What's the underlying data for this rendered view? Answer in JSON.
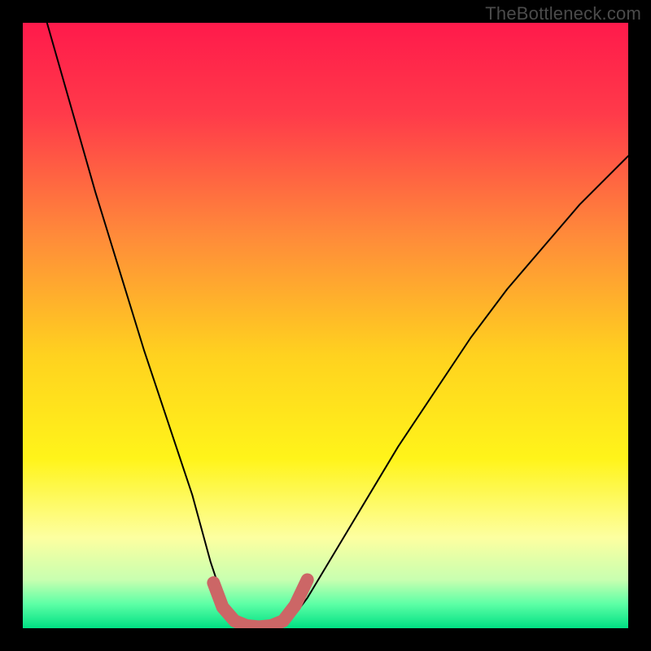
{
  "watermark": "TheBottleneck.com",
  "chart_data": {
    "type": "line",
    "title": "",
    "xlabel": "",
    "ylabel": "",
    "x_range": [
      0,
      100
    ],
    "y_range": [
      0,
      100
    ],
    "gradient_stops": [
      {
        "offset": 0.0,
        "color": "#ff1a4b"
      },
      {
        "offset": 0.15,
        "color": "#ff3a4a"
      },
      {
        "offset": 0.35,
        "color": "#ff8a3a"
      },
      {
        "offset": 0.55,
        "color": "#ffd21f"
      },
      {
        "offset": 0.72,
        "color": "#fff41a"
      },
      {
        "offset": 0.85,
        "color": "#fdffa0"
      },
      {
        "offset": 0.92,
        "color": "#c8ffb0"
      },
      {
        "offset": 0.96,
        "color": "#5dffa6"
      },
      {
        "offset": 1.0,
        "color": "#00e083"
      }
    ],
    "curve": {
      "description": "V-shaped bottleneck curve; value is ~0 near x≈34–44 and rises steeply toward both sides",
      "x": [
        0,
        4,
        8,
        12,
        16,
        20,
        24,
        28,
        31,
        33,
        36,
        40,
        44,
        47,
        50,
        56,
        62,
        68,
        74,
        80,
        86,
        92,
        98,
        100
      ],
      "y": [
        118,
        100,
        86,
        72,
        59,
        46,
        34,
        22,
        11,
        5,
        1,
        0,
        1,
        5,
        10,
        20,
        30,
        39,
        48,
        56,
        63,
        70,
        76,
        78
      ]
    },
    "trough_overlay": {
      "description": "Thick salmon-colored rounded U overlay marking the flat trough",
      "color": "#cc6666",
      "stroke_width": 16,
      "x": [
        31.5,
        33,
        35,
        37,
        39,
        41,
        43,
        45,
        47
      ],
      "y": [
        7.5,
        3.5,
        1.2,
        0.4,
        0.2,
        0.4,
        1.2,
        3.8,
        8.0
      ]
    }
  }
}
